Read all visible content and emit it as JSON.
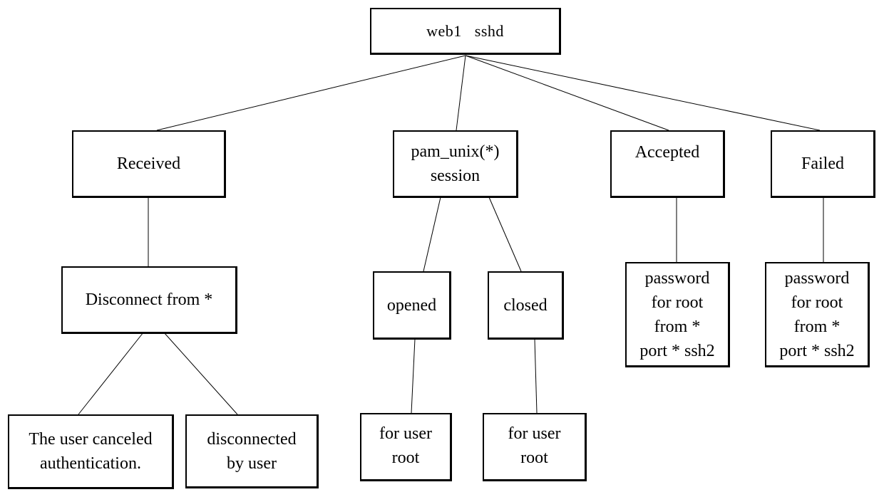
{
  "diagram": {
    "type": "tree",
    "root": {
      "id": "root",
      "label": "web1   sshd"
    },
    "nodes": [
      {
        "id": "received",
        "label": "Received",
        "parent": "root"
      },
      {
        "id": "pam",
        "label": "pam_unix(*)\nsession",
        "parent": "root"
      },
      {
        "id": "accepted",
        "label": "Accepted",
        "parent": "root"
      },
      {
        "id": "failed",
        "label": "Failed",
        "parent": "root"
      },
      {
        "id": "disconnect",
        "label": "Disconnect from *",
        "parent": "received"
      },
      {
        "id": "opened",
        "label": "opened",
        "parent": "pam"
      },
      {
        "id": "closed",
        "label": "closed",
        "parent": "pam"
      },
      {
        "id": "acc_pw",
        "label": "password\nfor root\nfrom *\nport * ssh2",
        "parent": "accepted"
      },
      {
        "id": "fail_pw",
        "label": "password\nfor root\nfrom *\nport * ssh2",
        "parent": "failed"
      },
      {
        "id": "canceled",
        "label": "The user canceled\nauthentication.",
        "parent": "disconnect"
      },
      {
        "id": "by_user",
        "label": "disconnected\nby user",
        "parent": "disconnect"
      },
      {
        "id": "opened_user",
        "label": "for user\nroot",
        "parent": "opened"
      },
      {
        "id": "closed_user",
        "label": "for user\nroot",
        "parent": "closed"
      }
    ]
  }
}
